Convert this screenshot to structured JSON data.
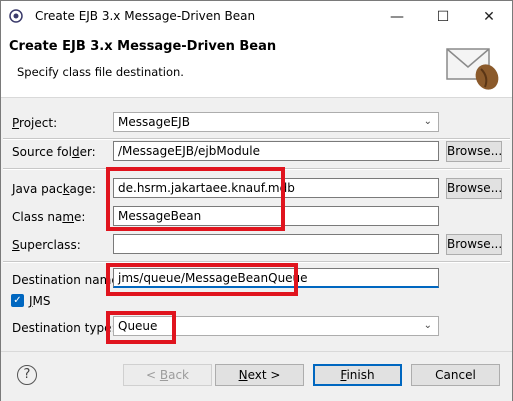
{
  "window": {
    "title": "Create EJB 3.x Message-Driven Bean",
    "minimize_glyph": "—",
    "maximize_glyph": "☐",
    "close_glyph": "✕"
  },
  "banner": {
    "title": "Create EJB 3.x Message-Driven Bean",
    "subtitle": "Specify class file destination.",
    "icon": "envelope-bean-icon"
  },
  "form": {
    "project": {
      "label_pre": "",
      "label_u": "P",
      "label_post": "roject:",
      "value": "MessageEJB"
    },
    "source_folder": {
      "label_pre": "Source fol",
      "label_u": "d",
      "label_post": "er:",
      "value": "/MessageEJB/ejbModule",
      "browse": "Browse..."
    },
    "java_package": {
      "label_pre": "Java pac",
      "label_u": "k",
      "label_post": "age:",
      "value": "de.hsrm.jakartaee.knauf.mdb",
      "browse": "Browse..."
    },
    "class_name": {
      "label_pre": "Class na",
      "label_u": "m",
      "label_post": "e:",
      "value": "MessageBean"
    },
    "superclass": {
      "label_pre": "",
      "label_u": "S",
      "label_post": "uperclass:",
      "value": "",
      "browse": "Browse..."
    },
    "destination_name": {
      "label": "Destination name:",
      "value": "jms/queue/MessageBeanQueue"
    },
    "jms": {
      "label_pre": "",
      "label_u": "J",
      "label_post": "MS",
      "checked": true
    },
    "destination_type": {
      "label": "Destination type:",
      "value": "Queue"
    }
  },
  "footer": {
    "help_glyph": "?",
    "back": {
      "pre": "< ",
      "u": "B",
      "post": "ack"
    },
    "next": {
      "pre": "",
      "u": "N",
      "post": "ext >"
    },
    "finish": {
      "pre": "",
      "u": "F",
      "post": "inish"
    },
    "cancel": "Cancel"
  },
  "colors": {
    "highlight": "#e0141e",
    "accent": "#0067c0"
  }
}
